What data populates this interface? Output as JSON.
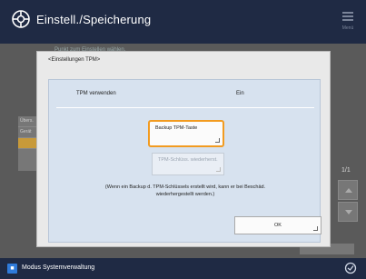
{
  "header": {
    "title": "Einstell./Speicherung",
    "menu_label": "Menü"
  },
  "background": {
    "subtitle": "Punkt zum Einstellen wählen.",
    "list_items": [
      "Übers.",
      "Gerät",
      ""
    ],
    "page_indicator": "1/1"
  },
  "dialog": {
    "title": "<Einstellungen TPM>",
    "setting_name": "TPM verwenden",
    "setting_value": "Ein",
    "backup_button": "Backup TPM-Taste",
    "restore_button": "TPM-Schlüss. wiederherst.",
    "note": "(Wenn ein Backup d. TPM-Schlüssels erstellt wird, kann er bei Beschäd. wiederhergestellt werden.)",
    "ok_button": "OK"
  },
  "footer": {
    "mode_text": "Modus Systemverwaltung"
  },
  "colors": {
    "header": "#1f2a44",
    "highlight": "#f29b20",
    "panel": "#d7e2ef"
  }
}
